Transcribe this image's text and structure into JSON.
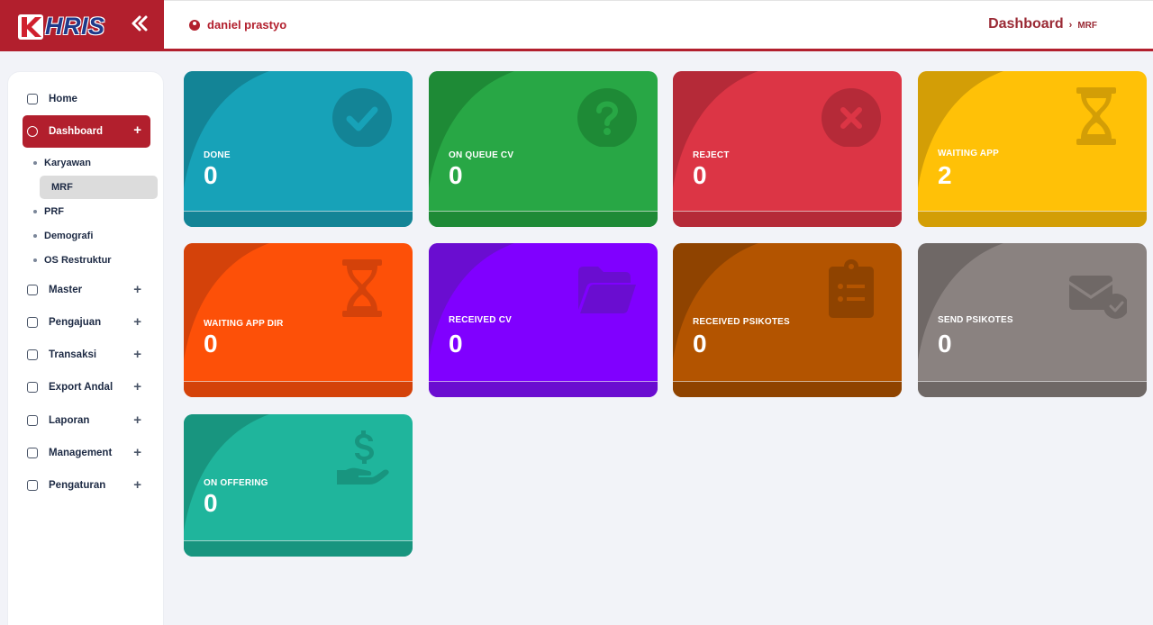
{
  "header": {
    "logo_text": "HRIS",
    "collapse_icon": "double-chevron-left-icon",
    "user_name": "daniel prastyo",
    "breadcrumb_main": "Dashboard",
    "breadcrumb_sep": "›",
    "breadcrumb_sub": "MRF"
  },
  "sidebar": {
    "items": [
      {
        "label": "Home",
        "icon": "home-icon"
      },
      {
        "label": "Dashboard",
        "icon": "dashboard-icon",
        "plus": "+"
      },
      {
        "label": "Master",
        "icon": "key-icon",
        "plus": "+"
      },
      {
        "label": "Pengajuan",
        "icon": "file-plus-icon",
        "plus": "+"
      },
      {
        "label": "Transaksi",
        "icon": "exchange-icon",
        "plus": "+"
      },
      {
        "label": "Export Andal",
        "icon": "export-icon",
        "plus": "+"
      },
      {
        "label": "Laporan",
        "icon": "report-icon",
        "plus": "+"
      },
      {
        "label": "Management",
        "icon": "calendar-icon",
        "plus": "+"
      },
      {
        "label": "Pengaturan",
        "icon": "settings-icon",
        "plus": "+"
      }
    ],
    "sub_items": [
      {
        "label": "Karyawan"
      },
      {
        "label": "MRF"
      },
      {
        "label": "PRF"
      },
      {
        "label": "Demografi"
      },
      {
        "label": "OS Restruktur"
      }
    ]
  },
  "cards": [
    {
      "label": "DONE",
      "value": "0",
      "icon": "check-circle-icon",
      "color": "#17a2b8",
      "dark": "#138496"
    },
    {
      "label": "ON QUEUE CV",
      "value": "0",
      "icon": "question-circle-icon",
      "color": "#28a745",
      "dark": "#1e8a36"
    },
    {
      "label": "REJECT",
      "value": "0",
      "icon": "times-circle-icon",
      "color": "#dc3545",
      "dark": "#b52a38"
    },
    {
      "label": "WAITING APP",
      "value": "2",
      "icon": "hourglass-icon",
      "color": "#ffc107",
      "dark": "#d39e06"
    },
    {
      "label": "WAITING APP DIR",
      "value": "0",
      "icon": "hourglass-icon",
      "color": "#fd5008",
      "dark": "#d4420a"
    },
    {
      "label": "RECEIVED CV",
      "value": "0",
      "icon": "folder-open-icon",
      "color": "#8000ff",
      "dark": "#6a0dd0"
    },
    {
      "label": "RECEIVED PSIKOTES",
      "value": "0",
      "icon": "clipboard-list-icon",
      "color": "#b35400",
      "dark": "#8f4300"
    },
    {
      "label": "SEND PSIKOTES",
      "value": "0",
      "icon": "envelope-check-icon",
      "color": "#8a8280",
      "dark": "#6f6866"
    },
    {
      "label": "ON OFFERING",
      "value": "0",
      "icon": "hand-dollar-icon",
      "color": "#1fb59c",
      "dark": "#18957f"
    }
  ]
}
